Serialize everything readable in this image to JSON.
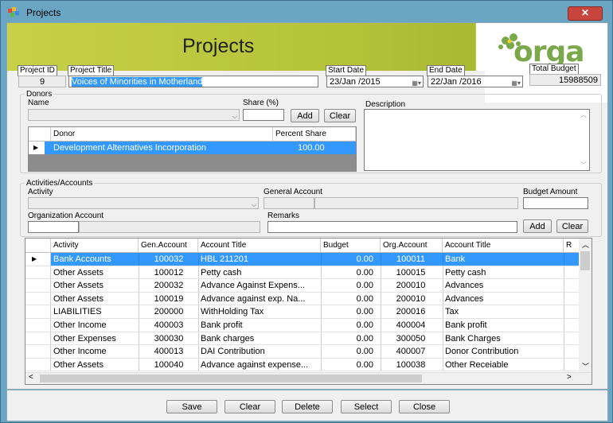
{
  "window": {
    "title": "Projects",
    "close_glyph": "✕",
    "app_icon": "projects-app-icon"
  },
  "banner": {
    "title": "Projects",
    "logo_text": "orga"
  },
  "project": {
    "id_label": "Project ID",
    "id_value": "9",
    "title_label": "Project Title",
    "title_value": "Voices of Minorities in Motherland",
    "start_label": "Start Date",
    "start_value": "23/Jan /2015",
    "end_label": "End Date",
    "end_value": "22/Jan /2016",
    "budget_label": "Total Budget",
    "budget_value": "15988509"
  },
  "donors": {
    "group_label": "Donors",
    "name_label": "Name",
    "share_label": "Share (%)",
    "add_label": "Add",
    "clear_label": "Clear",
    "description_label": "Description",
    "columns": [
      "Donor",
      "Percent Share"
    ],
    "rows": [
      {
        "donor": "Development Alternatives Incorporation",
        "share": "100.00"
      }
    ]
  },
  "activities": {
    "group_label": "Activities/Accounts",
    "activity_label": "Activity",
    "general_account_label": "General Account",
    "budget_amount_label": "Budget Amount",
    "org_account_label": "Organization Account",
    "remarks_label": "Remarks",
    "add_label": "Add",
    "clear_label": "Clear",
    "columns": [
      "Activity",
      "Gen.Account",
      "Account Title",
      "Budget",
      "Org.Account",
      "Account Title",
      "R"
    ],
    "rows": [
      {
        "activity": "Bank Accounts",
        "gen": "100032",
        "title": "HBL 211201",
        "budget": "0.00",
        "org": "100011",
        "org_title": "Bank"
      },
      {
        "activity": "Other Assets",
        "gen": "100012",
        "title": "Petty cash",
        "budget": "0.00",
        "org": "100015",
        "org_title": "Petty cash"
      },
      {
        "activity": "Other Assets",
        "gen": "200032",
        "title": "Advance Against Expens...",
        "budget": "0.00",
        "org": "200010",
        "org_title": "Advances"
      },
      {
        "activity": "Other Assets",
        "gen": "100019",
        "title": "Advance against exp. Na...",
        "budget": "0.00",
        "org": "200010",
        "org_title": "Advances"
      },
      {
        "activity": "LIABILITIES",
        "gen": "200000",
        "title": "WithHolding Tax",
        "budget": "0.00",
        "org": "200016",
        "org_title": "Tax"
      },
      {
        "activity": "Other Income",
        "gen": "400003",
        "title": "Bank profit",
        "budget": "0.00",
        "org": "400004",
        "org_title": "Bank profit"
      },
      {
        "activity": "Other Expenses",
        "gen": "300030",
        "title": "Bank charges",
        "budget": "0.00",
        "org": "300050",
        "org_title": "Bank Charges"
      },
      {
        "activity": "Other Income",
        "gen": "400013",
        "title": "DAI Contribution",
        "budget": "0.00",
        "org": "400007",
        "org_title": "Donor Contribution"
      },
      {
        "activity": "Other Assets",
        "gen": "100040",
        "title": "Advance against expense...",
        "budget": "0.00",
        "org": "100038",
        "org_title": "Other Receiable"
      }
    ]
  },
  "buttons": {
    "save": "Save",
    "clear": "Clear",
    "delete": "Delete",
    "select": "Select",
    "close": "Close"
  },
  "colors": {
    "selection": "#3399ff",
    "banner": "#b4c33a",
    "logo": "#7ba84b"
  }
}
